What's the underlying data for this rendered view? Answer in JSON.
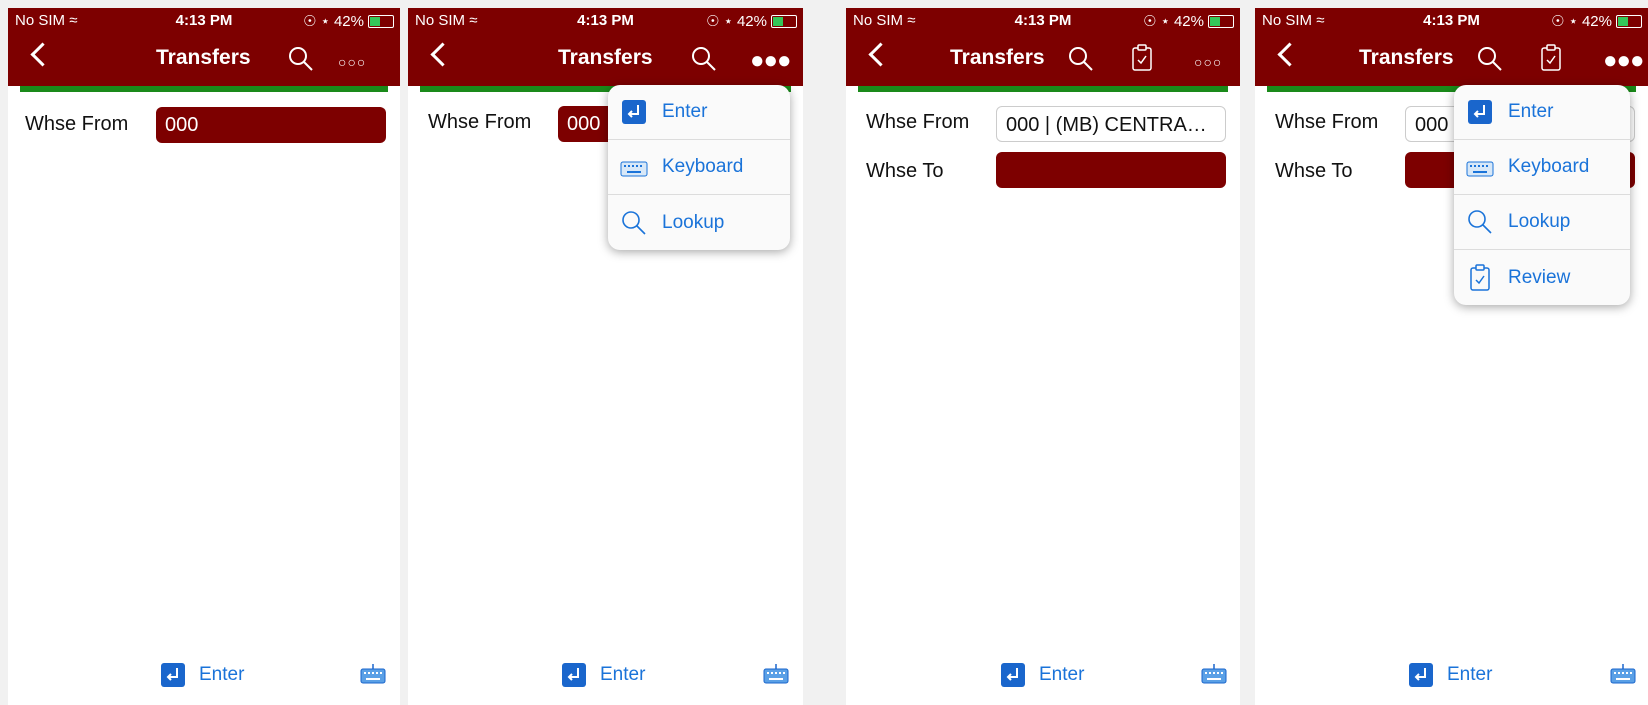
{
  "status": {
    "carrier": "No SIM",
    "time": "4:13 PM",
    "battery": "42%"
  },
  "title": "Transfers",
  "icons": {
    "back": "chevron-left-icon",
    "search": "search-icon",
    "review": "clipboard-check-icon",
    "more": "more-icon",
    "enter": "enter-icon",
    "keyboard": "keyboard-icon"
  },
  "colors": {
    "header": "#7d0000",
    "accent_bar": "#1a8a1a",
    "link": "#1a73d9"
  },
  "fields": {
    "whse_from_label": "Whse From",
    "whse_to_label": "Whse To",
    "whse_from_value_initial": "000",
    "whse_from_value_selected": "000 | (MB) CENTRA…",
    "whse_from_value_truncated": "000"
  },
  "footer": {
    "enter_label": "Enter"
  },
  "menu": {
    "enter": "Enter",
    "keyboard": "Keyboard",
    "lookup": "Lookup",
    "review": "Review"
  }
}
